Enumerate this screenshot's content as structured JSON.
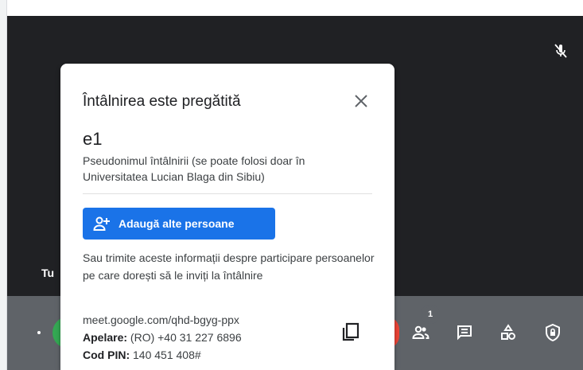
{
  "meeting": {
    "self_label": "Tu",
    "participant_count": "1"
  },
  "dialog": {
    "title": "Întâlnirea este pregătită",
    "code": "e1",
    "nickname_desc": "Pseudonimul întâlnirii (se poate folosi doar în Universitatea Lucian Blaga din Sibiu)",
    "add_button": "Adaugă alte persoane",
    "share_info": "Sau trimite aceste informații despre participare persoanelor pe care dorești să le inviți la întâlnire",
    "link": "meet.google.com/qhd-bgyg-ppx",
    "dial_label": "Apelare:",
    "dial_value": "(RO) +40 31 227 6896",
    "pin_label": "Cod PIN:",
    "pin_value": "140 451 408#"
  },
  "icons": [
    "mic-off-icon",
    "close-icon",
    "add-person-icon",
    "copy-icon",
    "people-icon",
    "chat-icon",
    "activities-icon",
    "host-controls-icon"
  ],
  "colors": {
    "accent": "#1a73e8",
    "stage": "#202124",
    "bar": "#5f6368",
    "join_green": "#34a853",
    "leave_red": "#ea4335"
  }
}
